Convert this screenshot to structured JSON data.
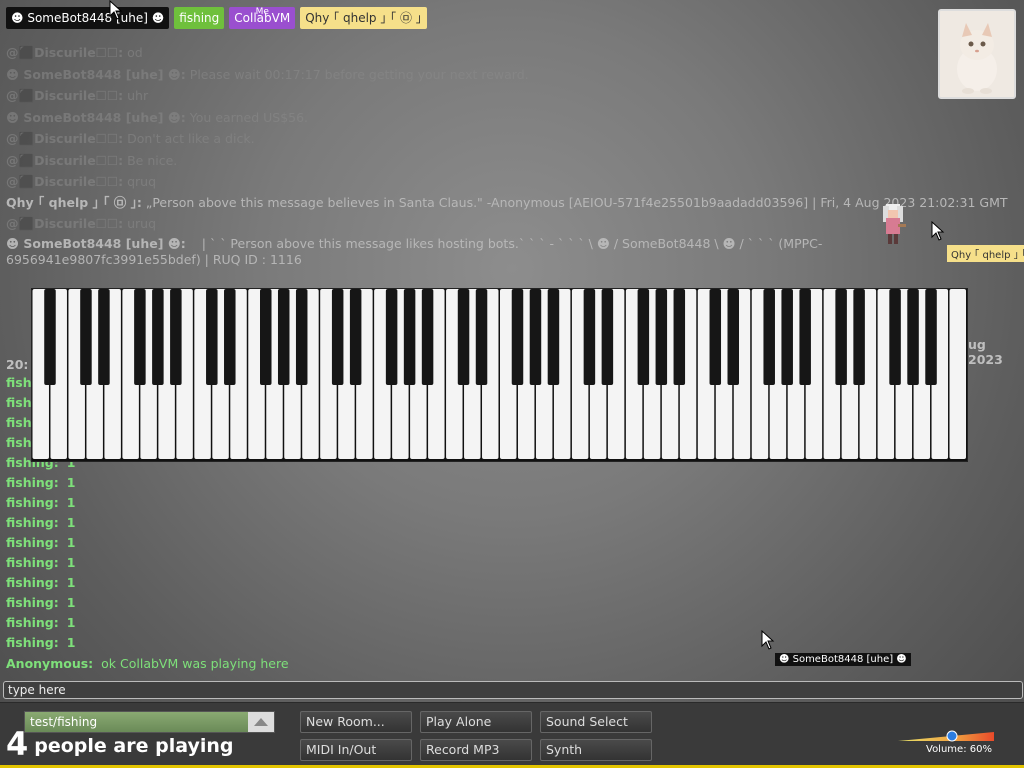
{
  "top_users": [
    {
      "name": "☻ SomeBot8448 [uhe] ☻",
      "style": "bot"
    },
    {
      "name": "fishing",
      "style": "fish"
    },
    {
      "name": "CollabVM",
      "style": "cvm",
      "tag": "Me"
    },
    {
      "name": "Qhy ｢ qhelp ｣ ｢ ㉤ ｣",
      "style": "qhy"
    }
  ],
  "chat": {
    "messages": [
      {
        "nick": "@⬛Discurile☐☐:",
        "text": "od",
        "cls": "faded"
      },
      {
        "nick": "☻ SomeBot8448 [uhe] ☻:",
        "text": "Please wait 00:17:17 before getting your next reward.",
        "cls": "faded"
      },
      {
        "nick": "@⬛Discurile☐☐:",
        "text": "uhr",
        "cls": "faded"
      },
      {
        "nick": "☻ SomeBot8448 [uhe] ☻:",
        "text": "You earned US$56.",
        "cls": "faded"
      },
      {
        "nick": "@⬛Discurile☐☐:",
        "text": "Don't act like a dick.",
        "cls": "faded"
      },
      {
        "nick": "@⬛Discurile☐☐:",
        "text": "Be nice.",
        "cls": "faded"
      },
      {
        "nick": "@⬛Discurile☐☐:",
        "text": "qruq",
        "cls": "faded"
      }
    ],
    "santa_message": {
      "nick": "Qhy ｢ qhelp ｣ ｢ ㉤ ｣:",
      "text": "„Person above this message believes in Santa Claus.\" -Anonymous [AEIOU-571f4e25501b9aadadd03596] | Fri, 4 Aug 2023 21:02:31 GMT"
    },
    "msg_uruq": {
      "nick": "@⬛Discurile☐☐:",
      "text": "uruq"
    },
    "bot_message": {
      "nick": "☻ SomeBot8448 [uhe] ☻:",
      "text": "| ` ` Person above this message likes hosting bots.` ` ` - ` ` ` \\ ☻ / SomeBot8448 \\ ☻ / ` ` ` (MPPC-6956941e9807fc3991e55bdef) | RUQ ID : 1116"
    },
    "partial_right": "ug 2023",
    "partial_left": "20:",
    "fishing_lines": [
      "1",
      "1",
      "1",
      "1",
      "1",
      "1",
      "1",
      "1",
      "1",
      "1",
      "1",
      "1",
      "1",
      "1"
    ],
    "fishing_nick": "fishing:",
    "last": {
      "nick": "Anonymous:",
      "text": "ok CollabVM was playing here"
    }
  },
  "cursors": {
    "qhy_label": "Qhy ｢ qhelp ｣ ｢",
    "bot_label": "☻ SomeBot8448 [uhe] ☻"
  },
  "input": {
    "placeholder": "type here"
  },
  "bottom": {
    "room": "test/fishing",
    "count_num": "4",
    "count_label": "people are playing",
    "buttons": {
      "new_room": "New Room...",
      "play_alone": "Play Alone",
      "sound_select": "Sound Select",
      "midi": "MIDI In/Out",
      "record": "Record MP3",
      "synth": "Synth"
    },
    "volume_label": "Volume: 60%",
    "volume": 0.6
  },
  "colors": {
    "bot_bg": "#111111",
    "fishing_bg": "#6fc03c",
    "collabvm_bg": "#9a4fcf",
    "qhy_bg": "#f6e08a",
    "chat_green": "#7ee07a",
    "bottom_accent": "#e3c400"
  }
}
